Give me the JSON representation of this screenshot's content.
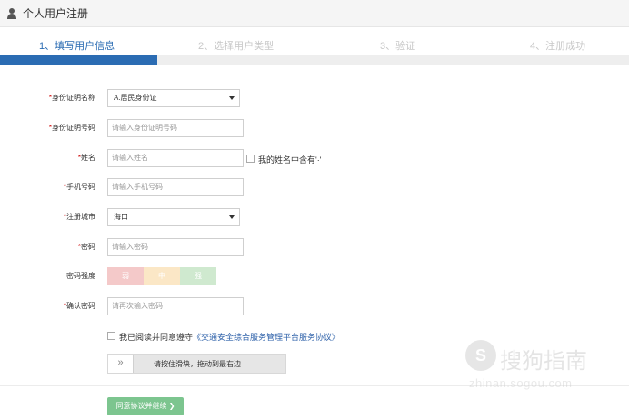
{
  "header": {
    "title": "个人用户注册",
    "icon": "user-icon"
  },
  "steps": [
    {
      "label": "1、填写用户信息",
      "active": true
    },
    {
      "label": "2、选择用户类型",
      "active": false
    },
    {
      "label": "3、验证",
      "active": false
    },
    {
      "label": "4、注册成功",
      "active": false
    }
  ],
  "progress": {
    "fraction": 0.25,
    "color": "#2b6cb3"
  },
  "form": {
    "id_type": {
      "label": "身份证明名称",
      "value": "A.居民身份证"
    },
    "id_number": {
      "label": "身份证明号码",
      "placeholder": "请输入身份证明号码"
    },
    "name": {
      "label": "姓名",
      "placeholder": "请输入姓名",
      "dot_checkbox": "我的姓名中含有'·'"
    },
    "phone": {
      "label": "手机号码",
      "placeholder": "请输入手机号码"
    },
    "city": {
      "label": "注册城市",
      "value": "海口"
    },
    "password": {
      "label": "密码",
      "placeholder": "请输入密码"
    },
    "strength": {
      "label": "密码强度",
      "levels": [
        {
          "text": "弱",
          "color": "#f4c9c9"
        },
        {
          "text": "中",
          "color": "#fbe7c6"
        },
        {
          "text": "强",
          "color": "#cfe9cf"
        }
      ]
    },
    "confirm": {
      "label": "确认密码",
      "placeholder": "请再次输入密码"
    },
    "agree": {
      "prefix": "我已阅读并同意遵守",
      "link": "《交通安全综合服务管理平台服务协议》"
    },
    "slider": {
      "handle": "»",
      "hint": "请按住滑块，拖动到最右边"
    },
    "submit": "同意协议并继续 ❯",
    "required_mark": "*"
  },
  "watermark": {
    "logo": "S",
    "text": "搜狗指南",
    "url": "zhinan.sogou.com"
  }
}
